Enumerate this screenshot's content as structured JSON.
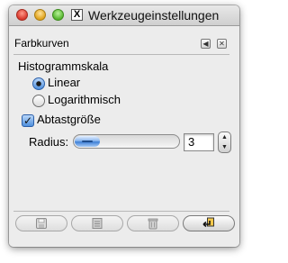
{
  "window": {
    "title": "Werkzeugeinstellungen"
  },
  "dock": {
    "title": "Farbkurven"
  },
  "histogram": {
    "label": "Histogrammskala",
    "options": [
      {
        "label": "Linear",
        "checked": true
      },
      {
        "label": "Logarithmisch",
        "checked": false
      }
    ]
  },
  "sample": {
    "label": "Abtastgröße",
    "checked": true,
    "radius_label": "Radius:",
    "radius_value": "3",
    "slider_level_fraction": 0.24
  },
  "toolbar": {
    "buttons": [
      {
        "icon": "save-icon",
        "enabled": false
      },
      {
        "icon": "restore-icon",
        "enabled": false
      },
      {
        "icon": "delete-icon",
        "enabled": false
      },
      {
        "icon": "reset-icon",
        "enabled": true
      }
    ]
  },
  "colors": {
    "accent": "#4f8fdc",
    "window_bg": "#ececec"
  }
}
